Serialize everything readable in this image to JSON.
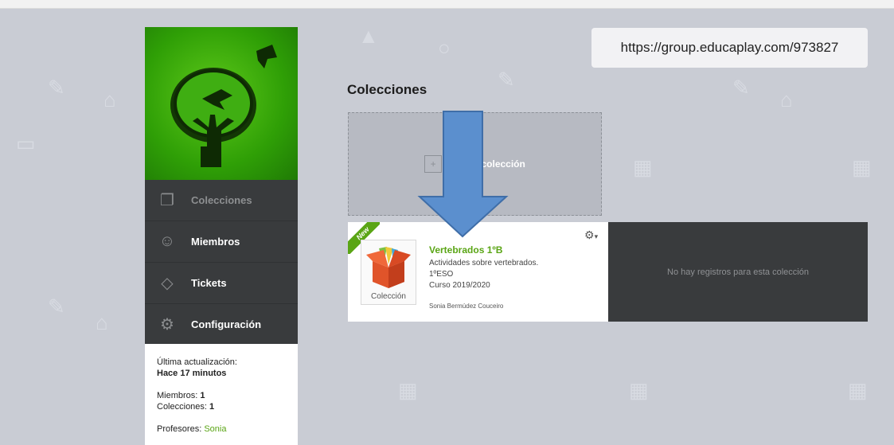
{
  "url": "https://group.educaplay.com/973827",
  "sidebar": {
    "menu": [
      {
        "label": "Colecciones",
        "icon": "collections-icon",
        "active": true
      },
      {
        "label": "Miembros",
        "icon": "members-icon",
        "active": false
      },
      {
        "label": "Tickets",
        "icon": "ticket-icon",
        "active": false
      },
      {
        "label": "Configuración",
        "icon": "gear-icon",
        "active": false
      }
    ],
    "info": {
      "last_update_label": "Última actualización:",
      "last_update_value": "Hace 17 minutos",
      "members_label": "Miembros:",
      "members_value": "1",
      "collections_label": "Colecciones:",
      "collections_value": "1",
      "teachers_label": "Profesores:",
      "teachers_value": "Sonia"
    }
  },
  "main": {
    "heading": "Colecciones",
    "new_collection_label": "Nueva colección",
    "card": {
      "badge": "New",
      "thumb_label": "Colección",
      "title": "Vertebrados 1ºB",
      "description": "Actividades sobre vertebrados.",
      "level": "1ºESO",
      "course": "Curso 2019/2020",
      "author": "Sonia Bermúdez Couceiro"
    },
    "empty_message": "No hay registros para esta colección"
  },
  "colors": {
    "accent_green": "#5aa515",
    "dark_panel": "#393b3d",
    "arrow_blue": "#5b8fce"
  }
}
